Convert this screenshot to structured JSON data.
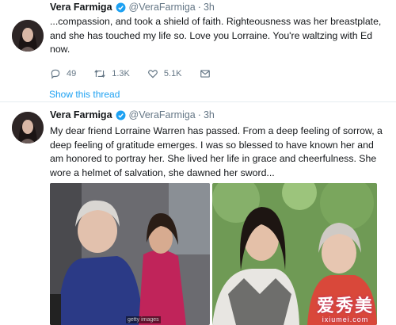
{
  "colors": {
    "link": "#1da1f2",
    "secondary": "#657786",
    "verified": "#1da1f2"
  },
  "tweets": [
    {
      "name": "Vera Farmiga",
      "handle": "@VeraFarmiga",
      "time": "3h",
      "text": "...compassion, and took a shield of faith. Righteousness was her breastplate, and she has touched my life so. Love you Lorraine. You're waltzing with Ed now.",
      "replies": "49",
      "retweets": "1.3K",
      "likes": "5.1K",
      "show_thread": "Show this thread"
    },
    {
      "name": "Vera Farmiga",
      "handle": "@VeraFarmiga",
      "time": "3h",
      "text": "My dear friend Lorraine Warren has passed. From a deep feeling of sorrow, a deep feeling of gratitude emerges. I was so blessed to have known her and am honored to portray her. She lived her life in grace and cheerfulness. She wore a helmet of salvation, she dawned her sword..."
    }
  ],
  "photo_credit": "getty images",
  "watermark": {
    "main": "爱秀美",
    "sub": "ixiumei.com"
  },
  "dot": "·"
}
